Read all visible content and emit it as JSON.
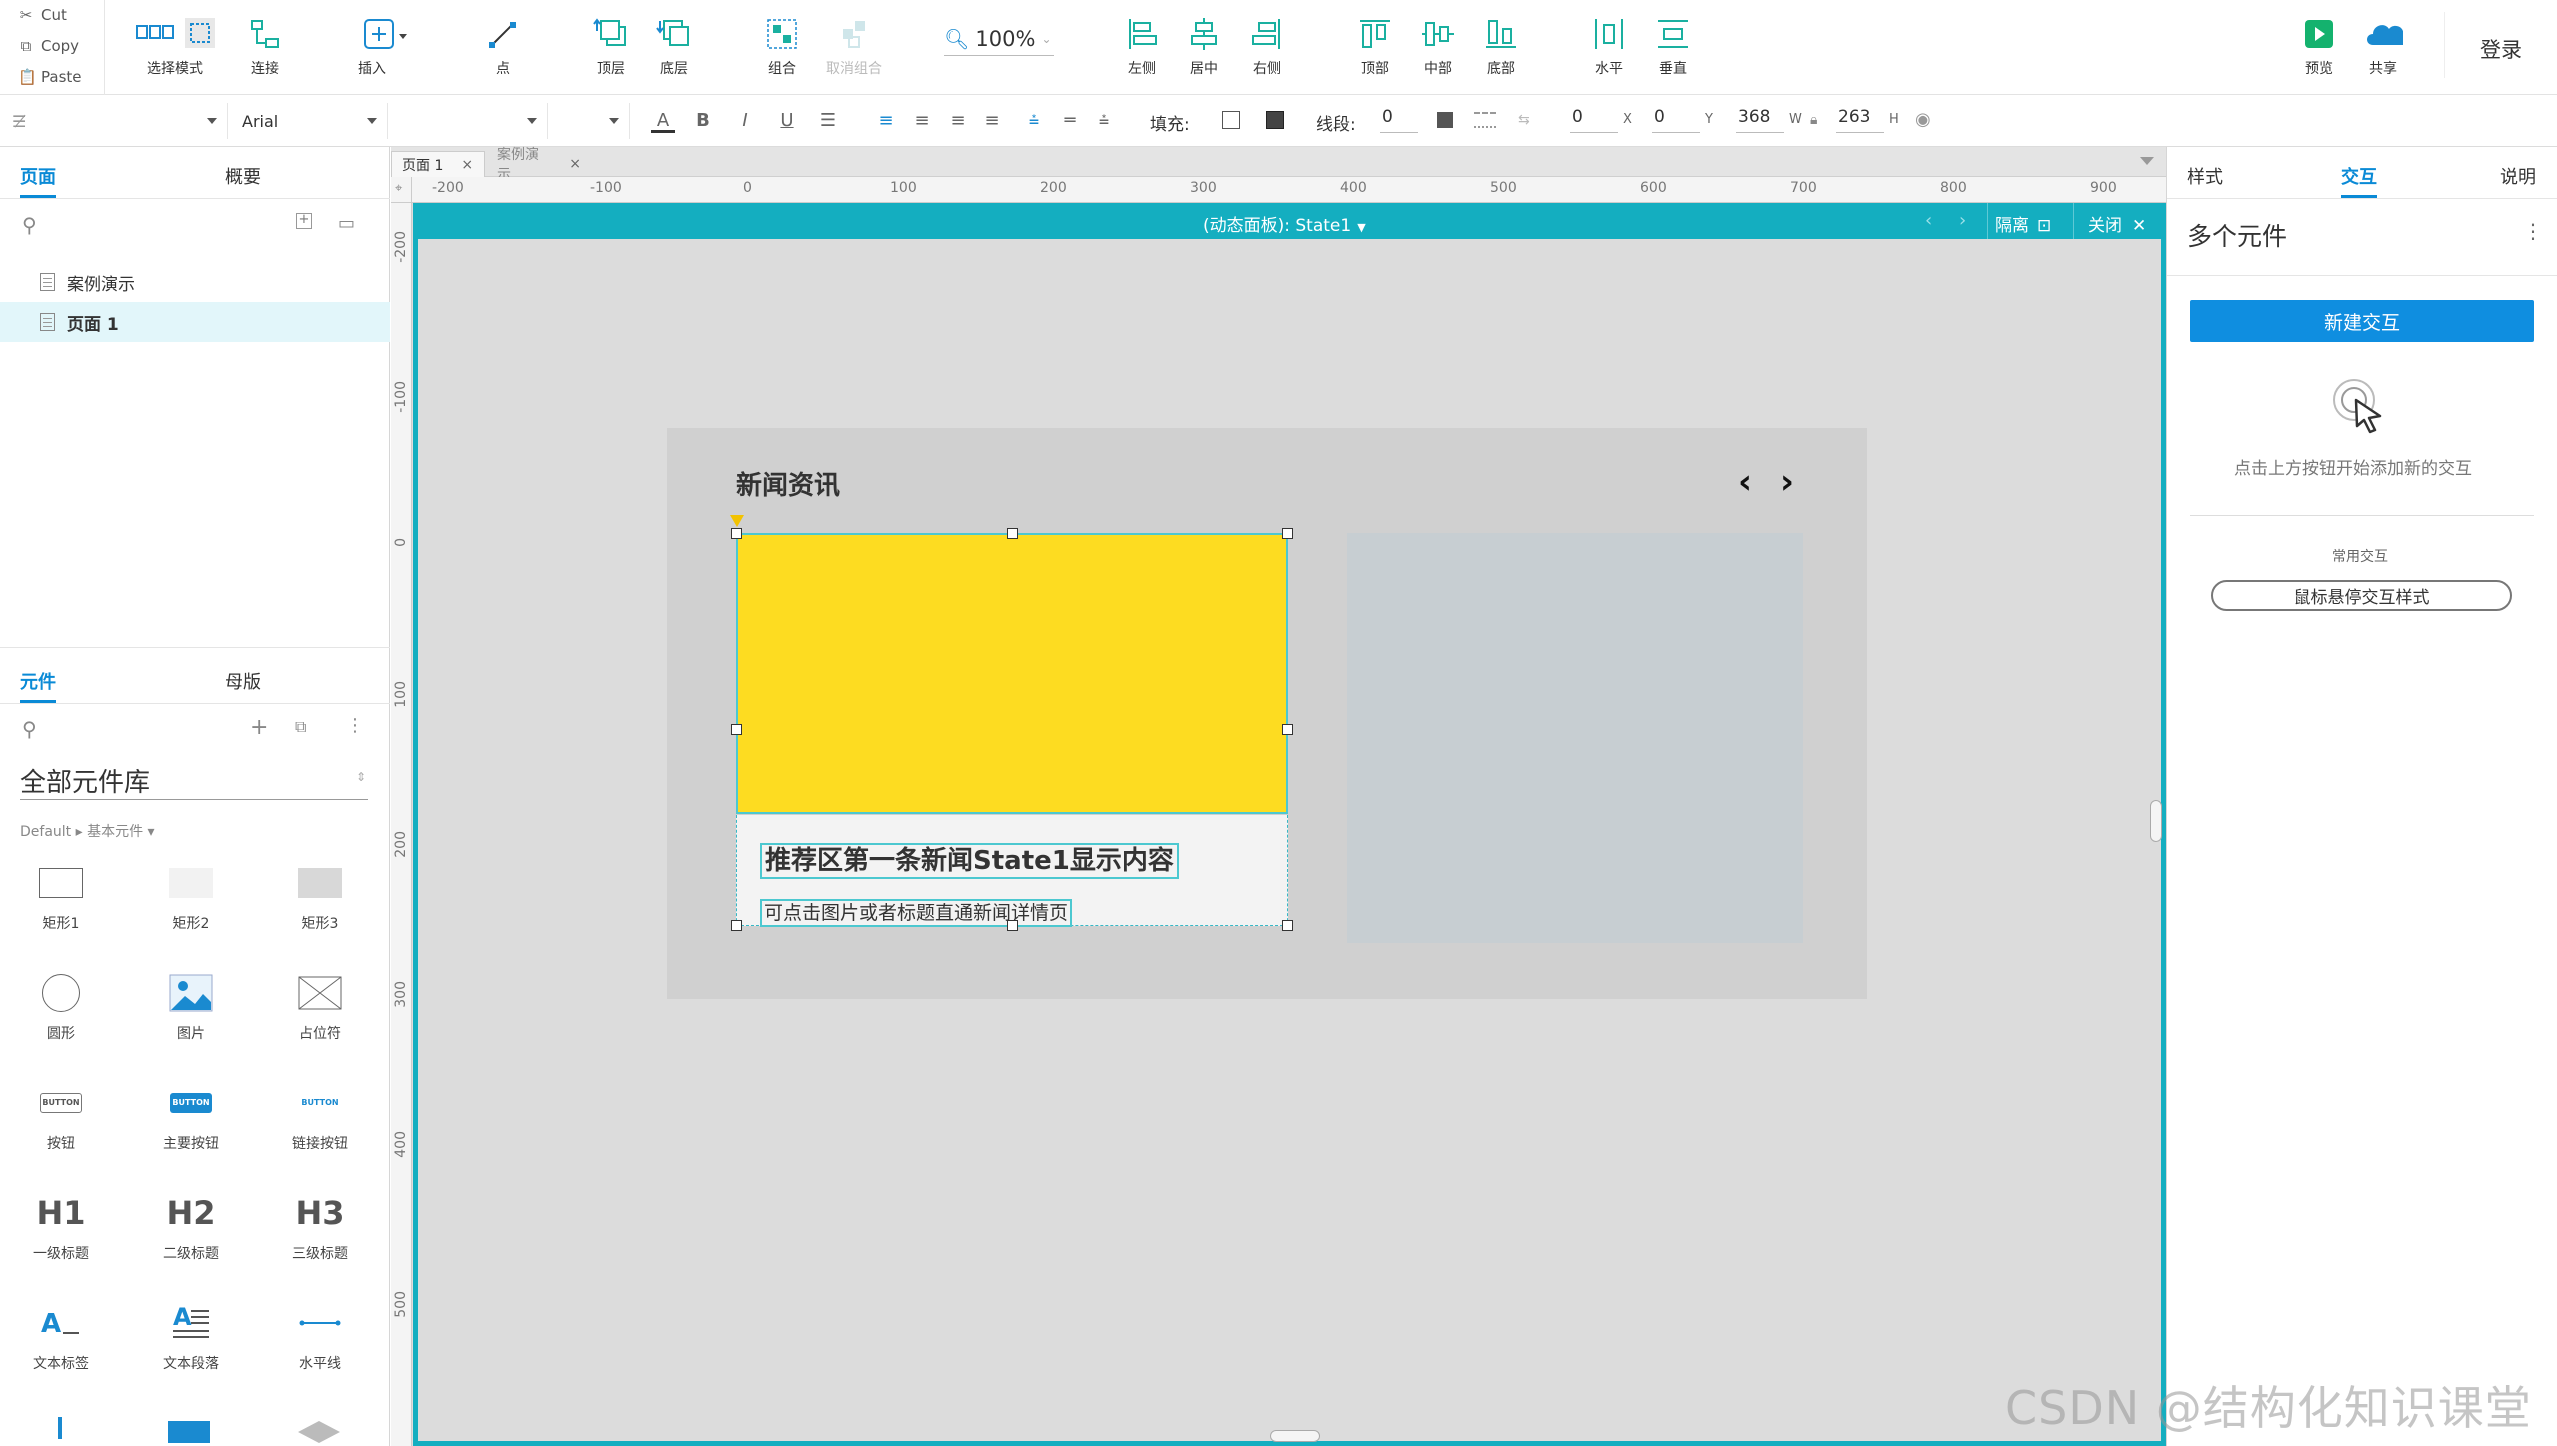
{
  "clipboard": {
    "cut": "Cut",
    "copy": "Copy",
    "paste": "Paste"
  },
  "toolbar": {
    "select_mode": "选择模式",
    "connect": "连接",
    "insert": "插入",
    "point": "点",
    "top_layer": "顶层",
    "bottom_layer": "底层",
    "group": "组合",
    "ungroup": "取消组合",
    "zoom": "100%",
    "align_left": "左侧",
    "align_center": "居中",
    "align_right": "右侧",
    "align_top": "顶部",
    "align_middle": "中部",
    "align_bottom": "底部",
    "dist_horizontal": "水平",
    "dist_vertical": "垂直",
    "preview": "预览",
    "share": "共享",
    "login": "登录"
  },
  "format": {
    "font": "Arial",
    "fill_label": "填充:",
    "line_label": "线段:",
    "line_value": "0",
    "x": "0",
    "x_unit": "X",
    "y": "0",
    "y_unit": "Y",
    "w": "368",
    "w_unit": "W",
    "h": "263",
    "h_unit": "H"
  },
  "left": {
    "tab_pages": "页面",
    "tab_outline": "概要",
    "pages": [
      {
        "label": "案例演示"
      },
      {
        "label": "页面 1"
      }
    ],
    "tab_widgets": "元件",
    "tab_masters": "母版",
    "library": "全部元件库",
    "library_sub": "Default ▸ 基本元件 ▾",
    "widgets": [
      "矩形1",
      "矩形2",
      "矩形3",
      "圆形",
      "图片",
      "占位符",
      "按钮",
      "主要按钮",
      "链接按钮",
      "一级标题",
      "二级标题",
      "三级标题",
      "文本标签",
      "文本段落",
      "水平线"
    ],
    "btn_text": "BUTTON",
    "h1": "H1",
    "h2": "H2",
    "h3": "H3"
  },
  "doc_tabs": [
    "页面 1",
    "案例演示"
  ],
  "ruler_h": [
    "-200",
    "-100",
    "0",
    "100",
    "200",
    "300",
    "400",
    "500",
    "600",
    "700",
    "800",
    "900"
  ],
  "ruler_v": [
    "-200",
    "-100",
    "0",
    "100",
    "200",
    "300",
    "400",
    "500"
  ],
  "dynamic_panel": {
    "label": "(动态面板): State1",
    "isolate": "隔离",
    "close": "关闭"
  },
  "canvas": {
    "news_title": "新闻资讯",
    "headline": "推荐区第一条新闻State1显示内容",
    "subline": "可点击图片或者标题直通新闻详情页"
  },
  "right": {
    "tab_style": "样式",
    "tab_interaction": "交互",
    "tab_notes": "说明",
    "title": "多个元件",
    "new_interaction": "新建交互",
    "hint": "点击上方按钮开始添加新的交互",
    "common": "常用交互",
    "hover_style": "鼠标悬停交互样式"
  },
  "watermark": "CSDN @结构化知识课堂",
  "colors": {
    "accent": "#0a8ad6",
    "panel": "#14aec0",
    "yellow": "#fddc21"
  }
}
